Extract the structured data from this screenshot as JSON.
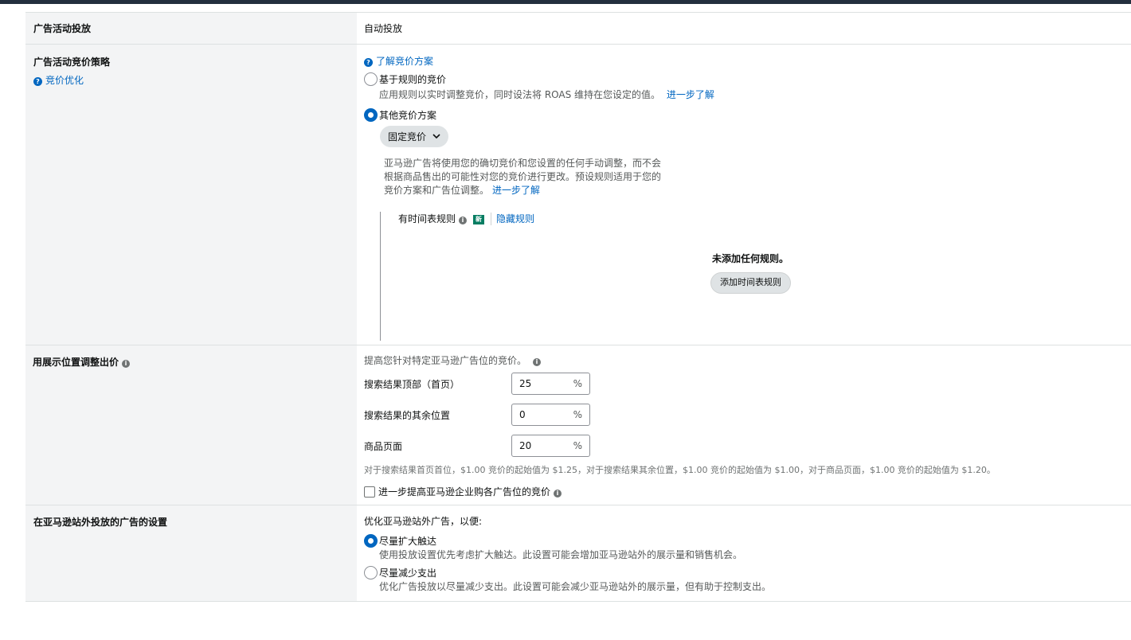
{
  "campaign_targeting": {
    "label": "广告活动投放",
    "value": "自动投放"
  },
  "bidding": {
    "label": "广告活动竞价策略",
    "help_link": "竞价优化",
    "learn_link": "了解竞价方案",
    "rule_based": {
      "title": "基于规则的竞价",
      "desc": "应用规则以实时调整竞价，同时设法将 ROAS 维持在您设定的值。",
      "more": "进一步了解"
    },
    "other": {
      "title": "其他竞价方案"
    },
    "strategy_select": "固定竞价",
    "description_lines": [
      "亚马逊广告将使用您的确切竞价和您设置的任何手动调整，而不会",
      "根据商品售出的可能性对您的竞价进行更改。预设规则适用于您的",
      "竞价方案和广告位调整。"
    ],
    "description_more": "进一步了解",
    "schedule": {
      "title": "有时间表规则",
      "badge": "新",
      "hide_link": "隐藏规则",
      "empty": "未添加任何规则。",
      "add_button": "添加时间表规则"
    }
  },
  "placement": {
    "label": "用展示位置调整出价",
    "intro": "提高您针对特定亚马逊广告位的竞价。",
    "rows": [
      {
        "name": "搜索结果顶部（首页）",
        "value": "25",
        "unit": "%"
      },
      {
        "name": "搜索结果的其余位置",
        "value": "0",
        "unit": "%"
      },
      {
        "name": "商品页面",
        "value": "20",
        "unit": "%"
      }
    ],
    "note": "对于搜索结果首页首位，$1.00 竞价的起始值为 $1.25，对于搜索结果其余位置，$1.00 竞价的起始值为 $1.00，对于商品页面，$1.00 竞价的起始值为 $1.20。",
    "business_checkbox": "进一步提高亚马逊企业购各广告位的竞价",
    "business_checked": false
  },
  "offsite": {
    "label": "在亚马逊站外投放的广告的设置",
    "intro": "优化亚马逊站外广告，以便:",
    "options": [
      {
        "title": "尽量扩大触达",
        "desc": "使用投放设置优先考虑扩大触达。此设置可能会增加亚马逊站外的展示量和销售机会。",
        "selected": true
      },
      {
        "title": "尽量减少支出",
        "desc": "优化广告投放以尽量减少支出。此设置可能会减少亚马逊站外的展示量，但有助于控制支出。",
        "selected": false
      }
    ]
  },
  "icons": {
    "help": "question-circle-icon",
    "info": "info-circle-icon",
    "dropdown": "chevron-down-icon"
  },
  "colors": {
    "link": "#0066c0",
    "label_bg": "#f3f4f5",
    "topbar": "#232f3e",
    "badge": "#067d62"
  }
}
